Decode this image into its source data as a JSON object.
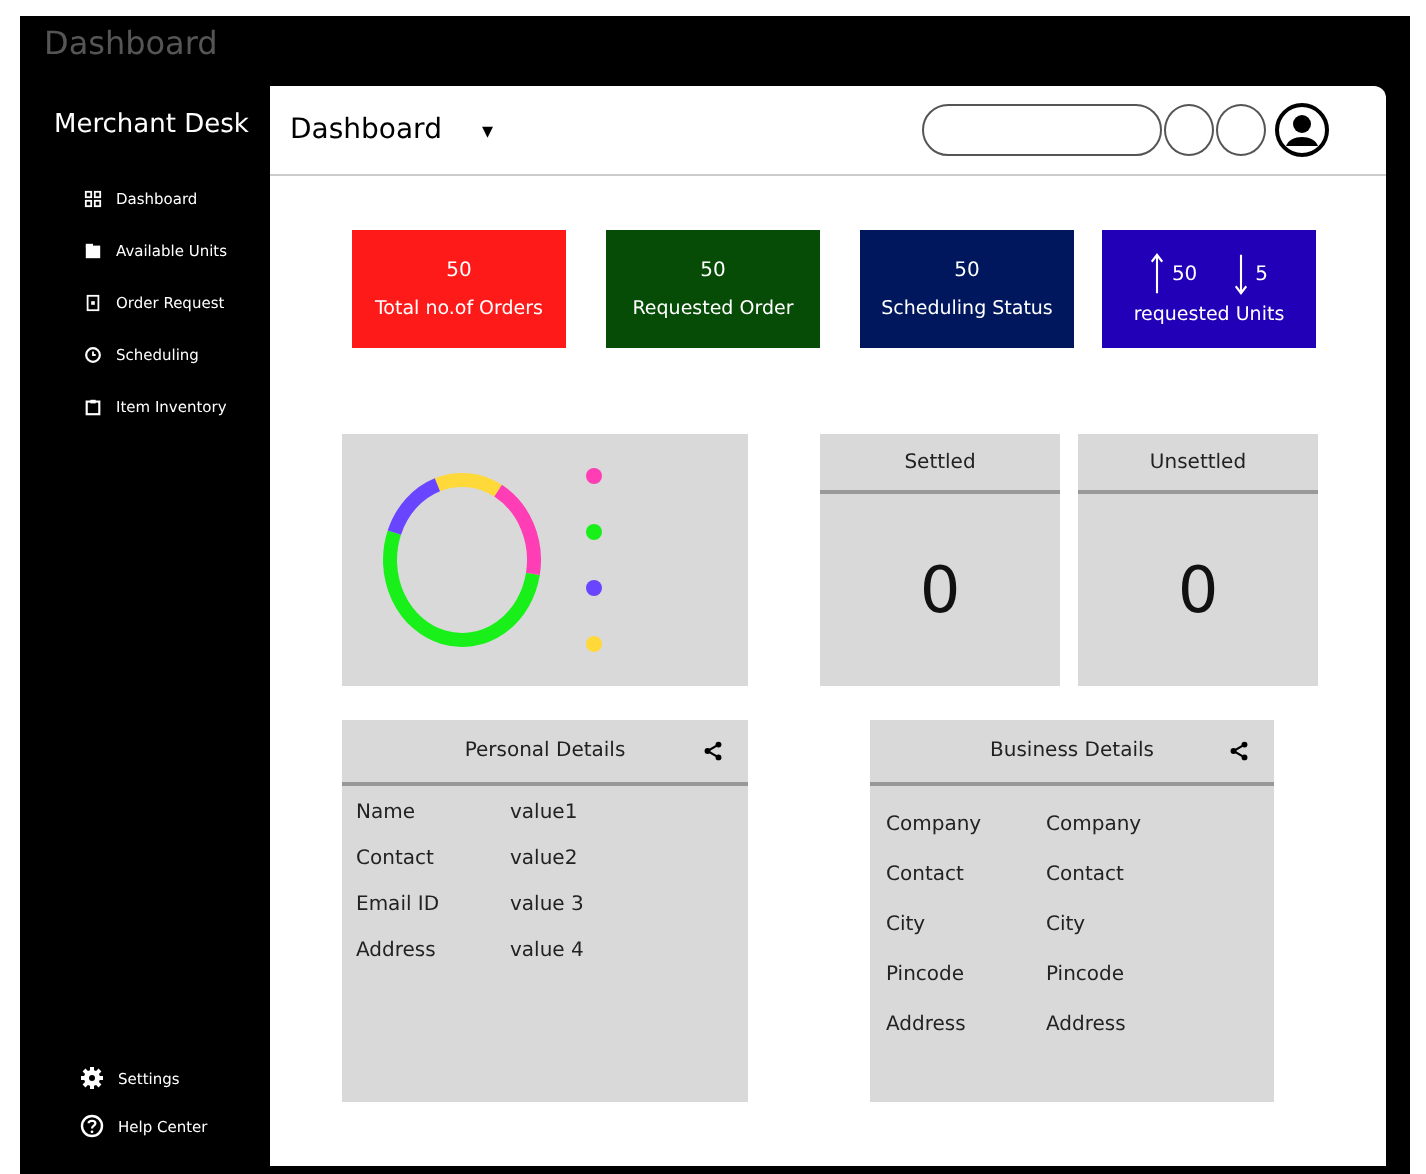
{
  "window": {
    "title": "Dashboard"
  },
  "sidebar": {
    "brand": "Merchant Desk",
    "items": [
      {
        "label": "Dashboard"
      },
      {
        "label": "Available Units"
      },
      {
        "label": "Order Request"
      },
      {
        "label": "Scheduling"
      },
      {
        "label": "Item Inventory"
      }
    ],
    "footer_items": [
      {
        "label": "Settings"
      },
      {
        "label": "Help Center"
      }
    ]
  },
  "header": {
    "page_select": "Dashboard",
    "caret": "▾"
  },
  "tiles": [
    {
      "kind": "single",
      "color": "#ff1a1a",
      "value": "50",
      "label": "Total no.of Orders"
    },
    {
      "kind": "single",
      "color": "#064c06",
      "value": "50",
      "label": "Requested Order"
    },
    {
      "kind": "single",
      "color": "#00175e",
      "value": "50",
      "label": "Scheduling Status"
    },
    {
      "kind": "in-out",
      "color": "#2100b8",
      "up": "50",
      "down": "5",
      "label": "requested Units"
    }
  ],
  "legend": [
    {
      "color": "#ff3eb5"
    },
    {
      "color": "#19f019"
    },
    {
      "color": "#6a45ff"
    },
    {
      "color": "#ffd83a"
    }
  ],
  "counters": [
    {
      "title": "Settled",
      "value": "0"
    },
    {
      "title": "Unsettled",
      "value": "0"
    }
  ],
  "details": [
    {
      "title": "Personal Details",
      "rows": [
        {
          "label": "Name",
          "value": "value1"
        },
        {
          "label": "Contact",
          "value": "value2"
        },
        {
          "label": "Email ID",
          "value": "value 3"
        },
        {
          "label": "Address",
          "value": "value 4"
        }
      ]
    },
    {
      "title": "Business Details",
      "rows": [
        {
          "label": "Company",
          "value": "Company"
        },
        {
          "label": "Contact",
          "value": "Contact"
        },
        {
          "label": "City",
          "value": "City"
        },
        {
          "label": "Pincode",
          "value": "Pincode"
        },
        {
          "label": "Address",
          "value": "Address"
        }
      ]
    }
  ]
}
